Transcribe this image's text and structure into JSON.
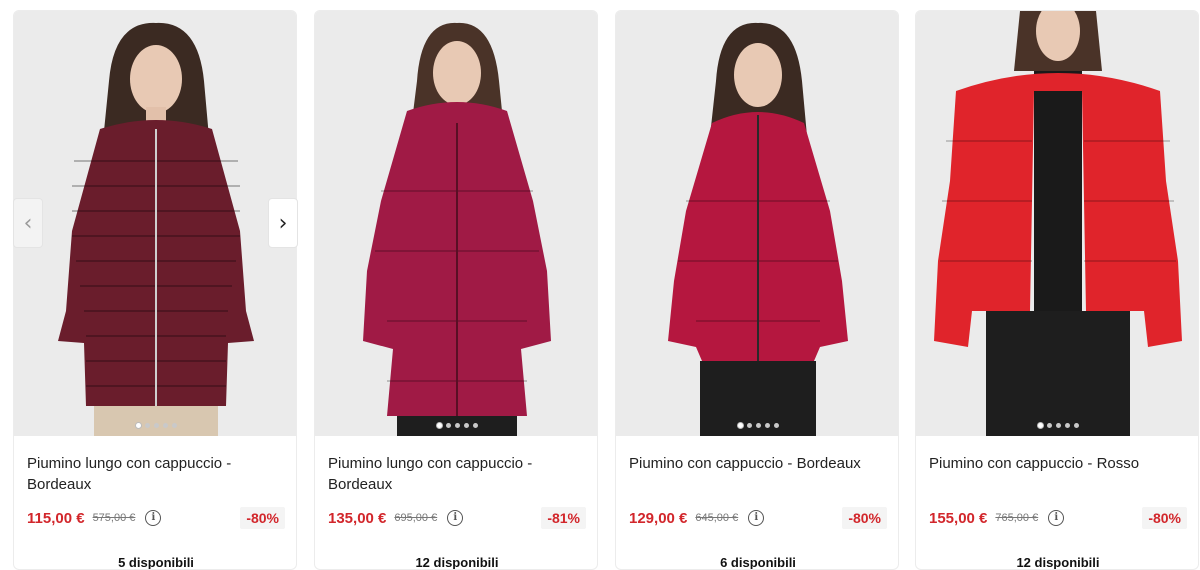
{
  "carousel": {
    "prev_icon": "‹",
    "next_icon": "›",
    "products": [
      {
        "title": "Piumino lungo con cappuccio - Bordeaux",
        "price": "115,00 €",
        "old_price": "575,00 €",
        "discount": "-80%",
        "stock": "5 disponibili",
        "jacket_color": "#6a1d2c",
        "image_dots": 5
      },
      {
        "title": "Piumino lungo con cappuccio - Bordeaux",
        "price": "135,00 €",
        "old_price": "695,00 €",
        "discount": "-81%",
        "stock": "12 disponibili",
        "jacket_color": "#a01a45",
        "image_dots": 5
      },
      {
        "title": "Piumino con cappuccio - Bordeaux",
        "price": "129,00 €",
        "old_price": "645,00 €",
        "discount": "-80%",
        "stock": "6 disponibili",
        "jacket_color": "#b5173f",
        "image_dots": 5
      },
      {
        "title": "Piumino con cappuccio - Rosso",
        "price": "155,00 €",
        "old_price": "765,00 €",
        "discount": "-80%",
        "stock": "12 disponibili",
        "jacket_color": "#e0242b",
        "image_dots": 5
      }
    ],
    "info_icon": "i"
  }
}
